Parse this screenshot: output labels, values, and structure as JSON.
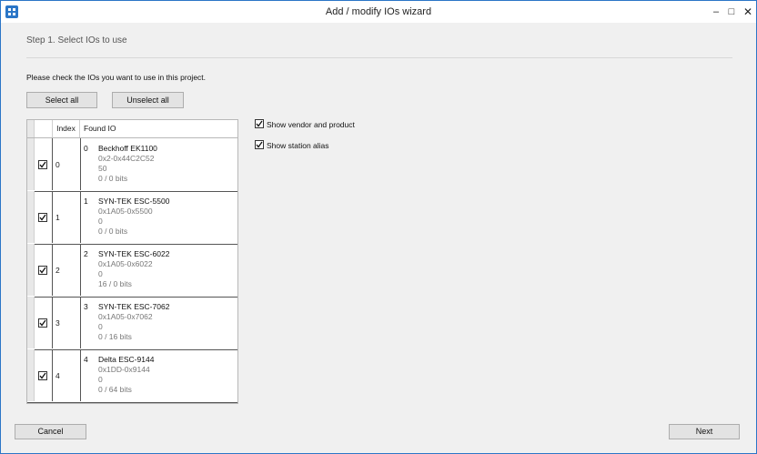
{
  "window": {
    "title": "Add / modify IOs wizard",
    "minimize_glyph": "–",
    "maximize_glyph": "□",
    "close_glyph": "✕",
    "icon": "app-logo-icon"
  },
  "wizard": {
    "step_title": "Step 1.  Select IOs to use",
    "instructions": "Please check the IOs you want to use in this project.",
    "select_all_label": "Select all",
    "unselect_all_label": "Unselect all",
    "cancel_label": "Cancel",
    "next_label": "Next"
  },
  "grid": {
    "columns": {
      "index": "Index",
      "found_io": "Found IO"
    },
    "rows": [
      {
        "checked": true,
        "index": "0",
        "num": "0",
        "name": "Beckhoff EK1100",
        "id": "0x2-0x44C2C52",
        "alias": "50",
        "bits": "0 / 0 bits"
      },
      {
        "checked": true,
        "index": "1",
        "num": "1",
        "name": "SYN-TEK ESC-5500",
        "id": "0x1A05-0x5500",
        "alias": "0",
        "bits": "0 / 0 bits"
      },
      {
        "checked": true,
        "index": "2",
        "num": "2",
        "name": "SYN-TEK ESC-6022",
        "id": "0x1A05-0x6022",
        "alias": "0",
        "bits": "16 / 0 bits"
      },
      {
        "checked": true,
        "index": "3",
        "num": "3",
        "name": "SYN-TEK ESC-7062",
        "id": "0x1A05-0x7062",
        "alias": "0",
        "bits": "0 / 16 bits"
      },
      {
        "checked": true,
        "index": "4",
        "num": "4",
        "name": "Delta ESC-9144",
        "id": "0x1DD-0x9144",
        "alias": "0",
        "bits": "0 / 64 bits"
      }
    ]
  },
  "options": {
    "show_vendor": {
      "label": "Show vendor and product",
      "checked": true
    },
    "show_alias": {
      "label": "Show station alias",
      "checked": true
    }
  },
  "colors": {
    "accent": "#2b76c7",
    "muted_text": "#777777"
  }
}
